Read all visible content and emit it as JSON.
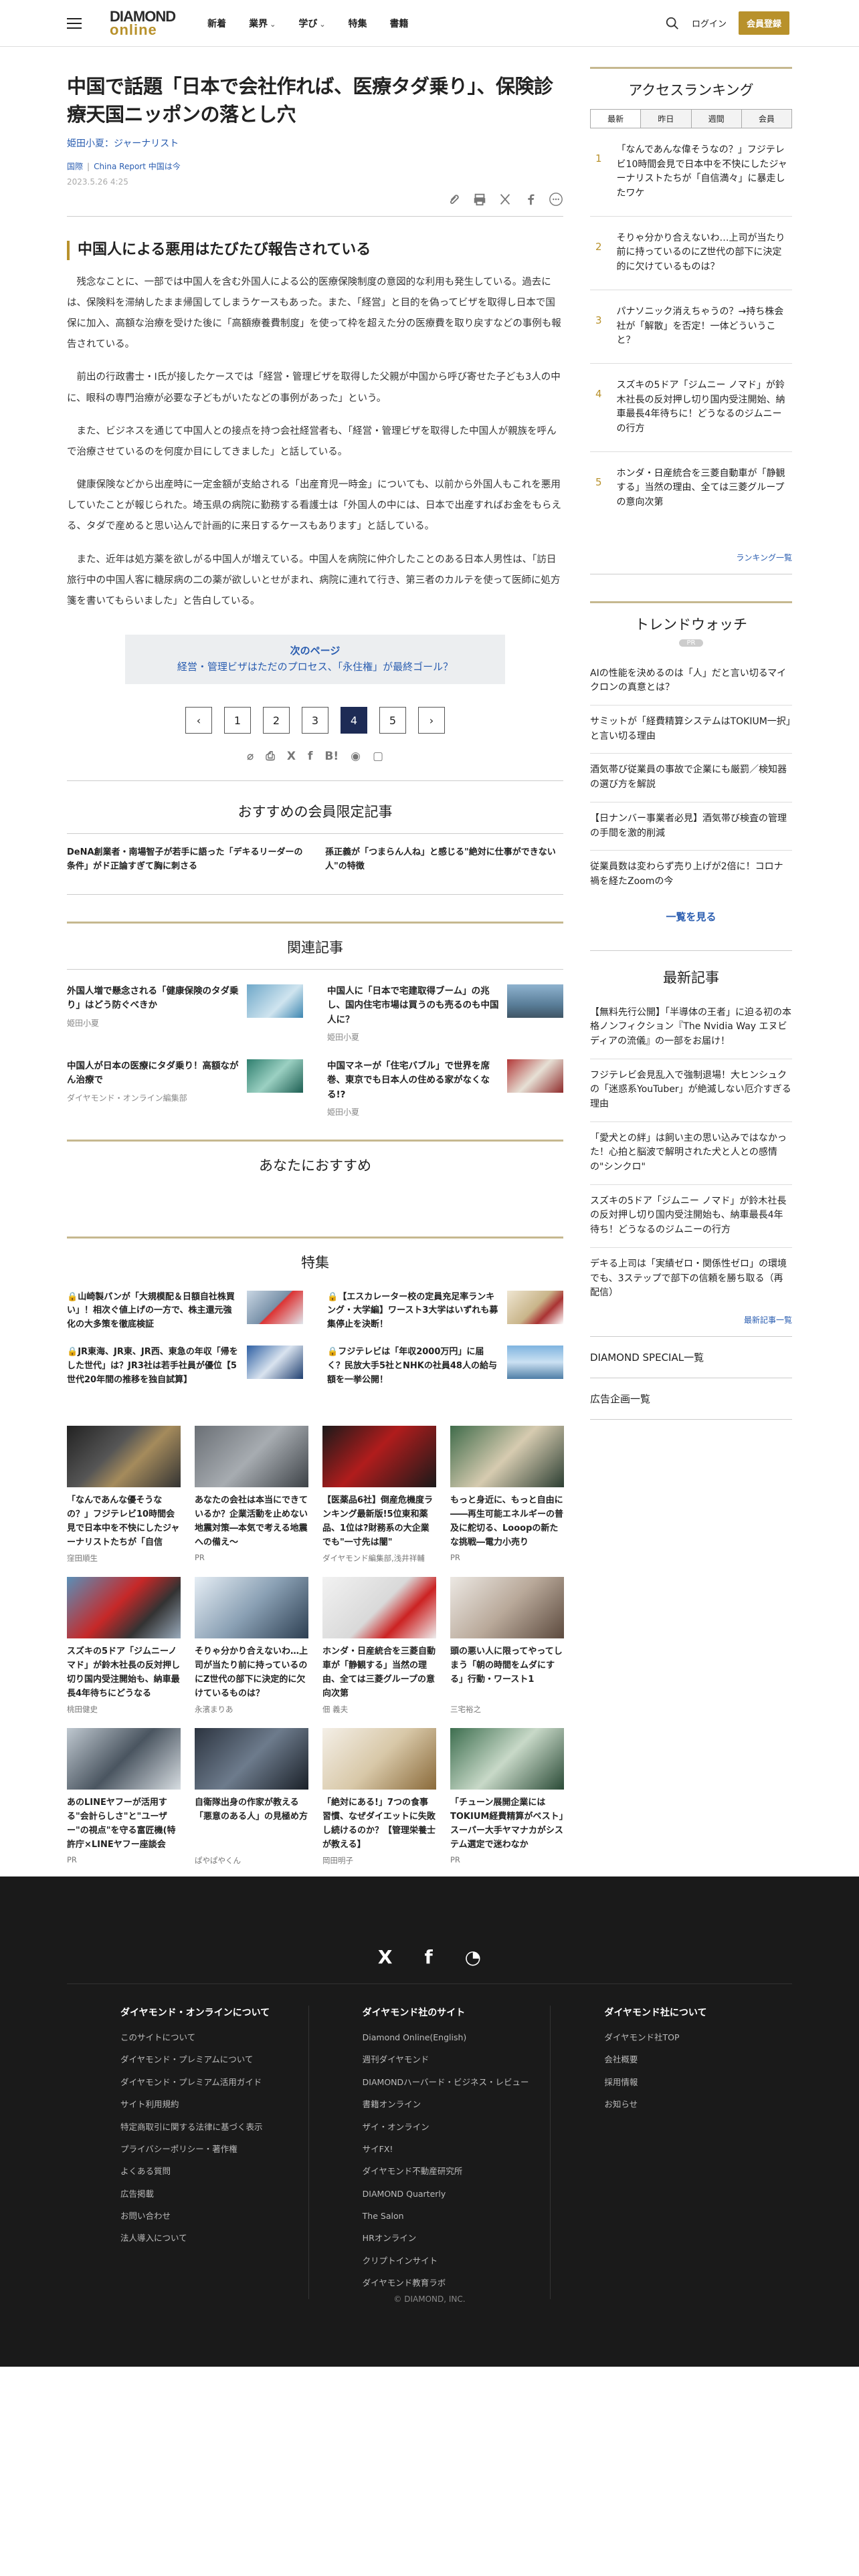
{
  "header": {
    "logo_top": "DIAMOND",
    "logo_bottom": "online",
    "nav": [
      "新着",
      "業界",
      "学び",
      "特集",
      "書籍"
    ],
    "login": "ログイン",
    "member_button": "会員登録"
  },
  "article": {
    "title": "中国で話題「日本で会社作れば、医療タダ乗り」、保険診療天国ニッポンの落とし穴",
    "author": "姫田小夏：ジャーナリスト",
    "category": "国際",
    "series": "China Report 中国は今",
    "date": "2023.5.26 4:25",
    "subheading": "中国人による悪用はたびたび報告されている",
    "paragraphs": [
      "残念なことに、一部では中国人を含む外国人による公的医療保険制度の意図的な利用も発生している。過去には、保険料を滞納したまま帰国してしまうケースもあった。また、「経営」と目的を偽ってビザを取得し日本で国保に加入、高額な治療を受けた後に「高額療養費制度」を使って枠を超えた分の医療費を取り戻すなどの事例も報告されている。",
      "前出の行政書士・I氏が接したケースでは「経営・管理ビザを取得した父親が中国から呼び寄せた子ども3人の中に、眼科の専門治療が必要な子どもがいたなどの事例があった」という。",
      "また、ビジネスを通じて中国人との接点を持つ会社経営者も、「経営・管理ビザを取得した中国人が親族を呼んで治療させているのを何度か目にしてきました」と話している。",
      "健康保険などから出産時に一定金額が支給される「出産育児一時金」についても、以前から外国人もこれを悪用していたことが報じられた。埼玉県の病院に勤務する看護士は「外国人の中には、日本で出産すればお金をもらえる、タダで産めると思い込んで計画的に来日するケースもあります」と話している。",
      "また、近年は処方薬を欲しがる中国人が増えている。中国人を病院に仲介したことのある日本人男性は、「訪日旅行中の中国人客に糖尿病の二の薬が欲しいとせがまれ、病院に連れて行き、第三者のカルテを使って医師に処方箋を書いてもらいました」と告白している。"
    ],
    "next_label": "次のページ",
    "next_title": "経営・管理ビザはただのプロセス、「永住権」が最終ゴール？",
    "pages": [
      "‹",
      "1",
      "2",
      "3",
      "4",
      "5",
      "›"
    ]
  },
  "members_section": {
    "title": "おすすめの会員限定記事",
    "items": [
      "DeNA創業者・南場智子が若手に語った「デキるリーダーの条件」がド正論すぎて胸に刺さる",
      "孫正義が「つまらん人ね」と感じる\"絶対に仕事ができない人\"の特徴"
    ]
  },
  "related_section": {
    "title": "関連記事",
    "items": [
      {
        "title": "外国人増で懸念される「健康保険のタダ乗り」はどう防ぐべきか",
        "author": "姫田小夏"
      },
      {
        "title": "中国人に「日本で宅建取得ブーム」の兆し、国内住宅市場は買うのも売るのも中国人に？",
        "author": "姫田小夏"
      },
      {
        "title": "中国人が日本の医療にタダ乗り！高額ながん治療で",
        "author": "ダイヤモンド・オンライン編集部"
      },
      {
        "title": "中国マネーが「住宅バブル」で世界を席巻、東京でも日本人の住める家がなくなる!?",
        "author": "姫田小夏"
      }
    ]
  },
  "recommend_section": {
    "title": "あなたにおすすめ"
  },
  "feature_section": {
    "title": "特集",
    "items": [
      "山崎製パンが「大規模配＆日額自社株買い」！相次ぐ値上げの一方で、株主還元強化の大多策を徹底検証",
      "【エスカレーター校の定員充足率ランキング・大学編】ワースト3大学はいずれも募集停止を決断！",
      "JR東海、JR東、JR西、東急の年収「帰をした世代」は？JR3社は若手社員が優位【5世代20年間の推移を独自試算】",
      "フジテレビは「年収2000万円」に届く？民放大手5社とNHKの社員48人の給与額を一挙公開！"
    ]
  },
  "cards": [
    {
      "title": "「なんであんな優そうなの？」フジテレビ10時間会見で日本中を不快にしたジャーナリストたちが「自信",
      "author": "窪田順生"
    },
    {
      "title": "あなたの会社は本当にできているか？企業活動を止めない地震対策―本気で考える地震への備え～",
      "author": "PR"
    },
    {
      "title": "【医薬品6社】倒産危機度ランキング最新版!5位東和薬品、1位は?財務系の大企業でも\"一寸先は闇\"",
      "author": "ダイヤモンド編集部,浅井祥輔"
    },
    {
      "title": "もっと身近に、もっと自由に――再生可能エネルギーの普及に舵切る、Looopの新たな挑戦―電力小売り",
      "author": "PR"
    },
    {
      "title": "スズキの5ドア「ジムニーノマド」が鈴木社長の反対押し切り国内受注開始も、納車最長4年待ちにどうなる",
      "author": "桃田健史"
    },
    {
      "title": "そりゃ分かり合えないわ…上司が当たり前に持っているのにZ世代の部下に決定的に欠けているものは？",
      "author": "永濱まりあ"
    },
    {
      "title": "ホンダ・日産統合を三菱自動車が「静観する」当然の理由、全ては三菱グループの意向次第",
      "author": "佃 義夫"
    },
    {
      "title": "頭の悪い人に限ってやってしまう「朝の時間をムダにする」行動・ワースト1",
      "author": "三宅裕之"
    },
    {
      "title": "あのLINEヤフーが活用する\"会計らしさ\"と\"ユーザー\"の視点\"を守る富匠機(特許庁×LINEヤフー座談会",
      "author": "PR"
    },
    {
      "title": "自衛隊出身の作家が教える「悪意のある人」の見極め方",
      "author": "ぱやぱやくん"
    },
    {
      "title": "「絶対にある!」7つの食事習慣、なぜダイエットに失敗し続けるのか？【管理栄養士が教える】",
      "author": "岡田明子"
    },
    {
      "title": "「チューン展開企業には TOKIUM経費精算がベスト」スーパー大手ヤマナカがシステム選定で迷わなか",
      "author": "PR"
    }
  ],
  "sidebar": {
    "ranking": {
      "title": "アクセスランキング",
      "tabs": [
        "最新",
        "昨日",
        "週間",
        "会員"
      ],
      "items": [
        {
          "n": "1",
          "t": "「なんであんな偉そうなの？」フジテレビ10時間会見で日本中を不快にしたジャーナリストたちが「自信満々」に暴走したワケ"
        },
        {
          "n": "2",
          "t": "そりゃ分かり合えないわ…上司が当たり前に持っているのにZ世代の部下に決定的に欠けているものは？"
        },
        {
          "n": "3",
          "t": "パナソニック消えちゃうの？→持ち株会社が「解散」を否定！一体どういうこと？"
        },
        {
          "n": "4",
          "t": "スズキの5ドア「ジムニー ノマド」が鈴木社長の反対押し切り国内受注開始、納車最長4年待ちに！どうなるのジムニーの行方"
        },
        {
          "n": "5",
          "t": "ホンダ・日産統合を三菱自動車が「静観する」当然の理由、全ては三菱グループの意向次第"
        }
      ],
      "more": "ランキング一覧"
    },
    "trend": {
      "title": "トレンドウォッチ",
      "pr": "PR",
      "items": [
        "AIの性能を決めるのは「人」だと言い切るマイクロンの真意とは？",
        "サミットが「経費精算システムはTOKIUM一択」と言い切る理由",
        "酒気帯び従業員の事故で企業にも厳罰／検知器の選び方を解説",
        "【日ナンバー事業者必見】酒気帯び検査の管理の手間を激的削減",
        "従業員数は変わらず売り上げが2倍に！コロナ禍を経たZoomの今"
      ],
      "more": "一覧を見る"
    },
    "news": {
      "title": "最新記事",
      "items": [
        "【無料先行公開】「半導体の王者」に迫る初の本格ノンフィクション『The Nvidia Way エヌビディアの流儀』の一部をお届け！",
        "フジテレビ会見乱入で強制退場！大ヒンシュクの「迷惑系YouTuber」が絶滅しない厄介すぎる理由",
        "「愛犬との絆」は飼い主の思い込みではなかった！心拍と脳波で解明された犬と人との感情の\"シンクロ\"",
        "スズキの5ドア「ジムニー ノマド」が鈴木社長の反対押し切り国内受注開始も、納車最長4年待ち！どうなるのジムニーの行方",
        "デキる上司は「実績ゼロ・関係性ゼロ」の環境でも、3ステップで部下の信頼を勝ち取る（再配信）"
      ],
      "more": "最新記事一覧"
    },
    "links": [
      "DIAMOND SPECIAL一覧",
      "広告企画一覧"
    ]
  },
  "footer": {
    "col1_title": "ダイヤモンド・オンラインについて",
    "col1": [
      "このサイトについて",
      "ダイヤモンド・プレミアムについて",
      "ダイヤモンド・プレミアム活用ガイド",
      "サイト利用規約",
      "特定商取引に関する法律に基づく表示",
      "プライバシーポリシー・著作権",
      "よくある質問",
      "広告掲載",
      "お問い合わせ",
      "法人導入について"
    ],
    "col2_title": "ダイヤモンド社のサイト",
    "col2": [
      "Diamond Online(English)",
      "週刊ダイヤモンド",
      "DIAMONDハーバード・ビジネス・レビュー",
      "書籍オンライン",
      "ザイ・オンライン",
      "サイFX!",
      "ダイヤモンド不動産研究所",
      "DIAMOND Quarterly",
      "The Salon",
      "HRオンライン",
      "クリプトインサイト",
      "ダイヤモンド教育ラボ"
    ],
    "col3_title": "ダイヤモンド社について",
    "col3": [
      "ダイヤモンド社TOP",
      "会社概要",
      "採用情報",
      "お知らせ"
    ],
    "copyright": "© DIAMOND, INC."
  },
  "colors": {
    "accent": "#b8912b",
    "link": "#2a5db0",
    "footer_bg": "#1a1a1a",
    "pager_current": "#1d2b55"
  }
}
